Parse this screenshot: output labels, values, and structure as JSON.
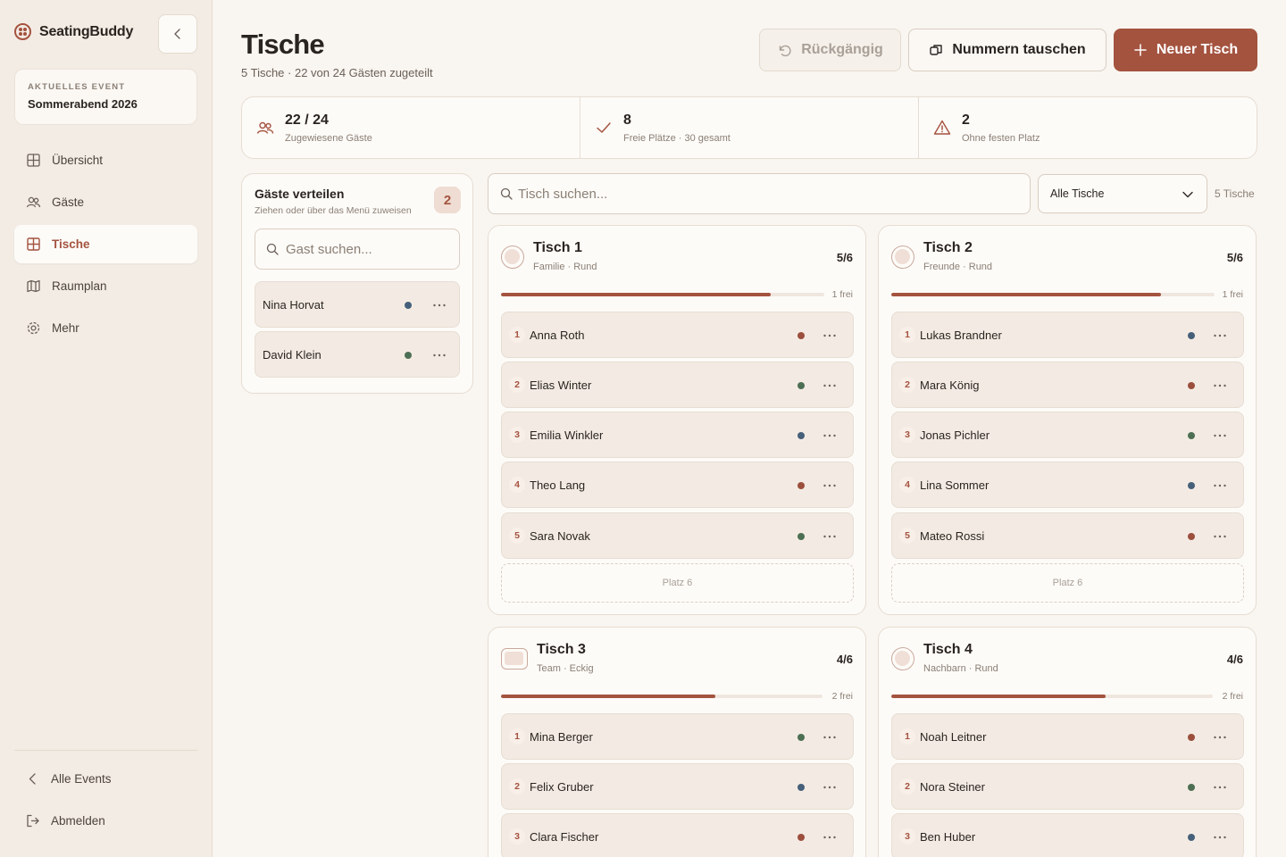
{
  "app": {
    "name": "SeatingBuddy"
  },
  "event": {
    "label": "AKTUELLES EVENT",
    "name": "Sommerabend 2026"
  },
  "nav": {
    "items": [
      {
        "label": "Übersicht",
        "icon": "grid-icon"
      },
      {
        "label": "Gäste",
        "icon": "users-icon"
      },
      {
        "label": "Tische",
        "icon": "table-grid-icon",
        "active": true
      },
      {
        "label": "Raumplan",
        "icon": "map-icon"
      },
      {
        "label": "Mehr",
        "icon": "gear-icon"
      }
    ],
    "bottom": [
      {
        "label": "Alle Events",
        "icon": "chevron-left-icon"
      },
      {
        "label": "Abmelden",
        "icon": "logout-icon"
      }
    ]
  },
  "header": {
    "title": "Tische",
    "subtitle": "5 Tische · 22 von 24 Gästen zugeteilt",
    "undo_label": "Rückgängig",
    "swap_label": "Nummern tauschen",
    "new_label": "Neuer Tisch"
  },
  "stats": [
    {
      "value": "22 / 24",
      "label": "Zugewiesene Gäste",
      "icon": "users-icon"
    },
    {
      "value": "8",
      "label": "Freie Plätze · 30 gesamt",
      "icon": "check-icon"
    },
    {
      "value": "2",
      "label": "Ohne festen Platz",
      "icon": "warning-icon"
    }
  ],
  "unassigned": {
    "title": "Gäste verteilen",
    "hint": "Ziehen oder über das Menü zuweisen",
    "count": "2",
    "search_placeholder": "Gast suchen...",
    "guests": [
      {
        "name": "Nina Horvat",
        "dot": "#46607a"
      },
      {
        "name": "David Klein",
        "dot": "#4d6f53"
      }
    ]
  },
  "toolbar": {
    "search_placeholder": "Tisch suchen...",
    "filter_value": "Alle Tische",
    "count_label": "5 Tische"
  },
  "colors": {
    "accent": "#a4533f",
    "blue": "#46607a",
    "green": "#4d6f53",
    "red": "#9c4f3d"
  },
  "tables": [
    {
      "name": "Tisch 1",
      "meta": "Familie · Rund",
      "occupancy": "5/6",
      "free": "1 frei",
      "fill": 0.833,
      "shape": "round",
      "seats": [
        {
          "num": "1",
          "name": "Anna Roth",
          "dot": "#9c4f3d"
        },
        {
          "num": "2",
          "name": "Elias Winter",
          "dot": "#4d6f53"
        },
        {
          "num": "3",
          "name": "Emilia Winkler",
          "dot": "#46607a"
        },
        {
          "num": "4",
          "name": "Theo Lang",
          "dot": "#9c4f3d"
        },
        {
          "num": "5",
          "name": "Sara Novak",
          "dot": "#4d6f53"
        }
      ],
      "empty": "Platz 6"
    },
    {
      "name": "Tisch 2",
      "meta": "Freunde · Rund",
      "occupancy": "5/6",
      "free": "1 frei",
      "fill": 0.833,
      "shape": "round",
      "seats": [
        {
          "num": "1",
          "name": "Lukas Brandner",
          "dot": "#46607a"
        },
        {
          "num": "2",
          "name": "Mara König",
          "dot": "#9c4f3d"
        },
        {
          "num": "3",
          "name": "Jonas Pichler",
          "dot": "#4d6f53"
        },
        {
          "num": "4",
          "name": "Lina Sommer",
          "dot": "#46607a"
        },
        {
          "num": "5",
          "name": "Mateo Rossi",
          "dot": "#9c4f3d"
        }
      ],
      "empty": "Platz 6"
    },
    {
      "name": "Tisch 3",
      "meta": "Team · Eckig",
      "occupancy": "4/6",
      "free": "2 frei",
      "fill": 0.667,
      "shape": "square",
      "seats": [
        {
          "num": "1",
          "name": "Mina Berger",
          "dot": "#4d6f53"
        },
        {
          "num": "2",
          "name": "Felix Gruber",
          "dot": "#46607a"
        },
        {
          "num": "3",
          "name": "Clara Fischer",
          "dot": "#9c4f3d"
        }
      ]
    },
    {
      "name": "Tisch 4",
      "meta": "Nachbarn · Rund",
      "occupancy": "4/6",
      "free": "2 frei",
      "fill": 0.667,
      "shape": "round",
      "seats": [
        {
          "num": "1",
          "name": "Noah Leitner",
          "dot": "#9c4f3d"
        },
        {
          "num": "2",
          "name": "Nora Steiner",
          "dot": "#4d6f53"
        },
        {
          "num": "3",
          "name": "Ben Huber",
          "dot": "#46607a"
        }
      ]
    }
  ]
}
